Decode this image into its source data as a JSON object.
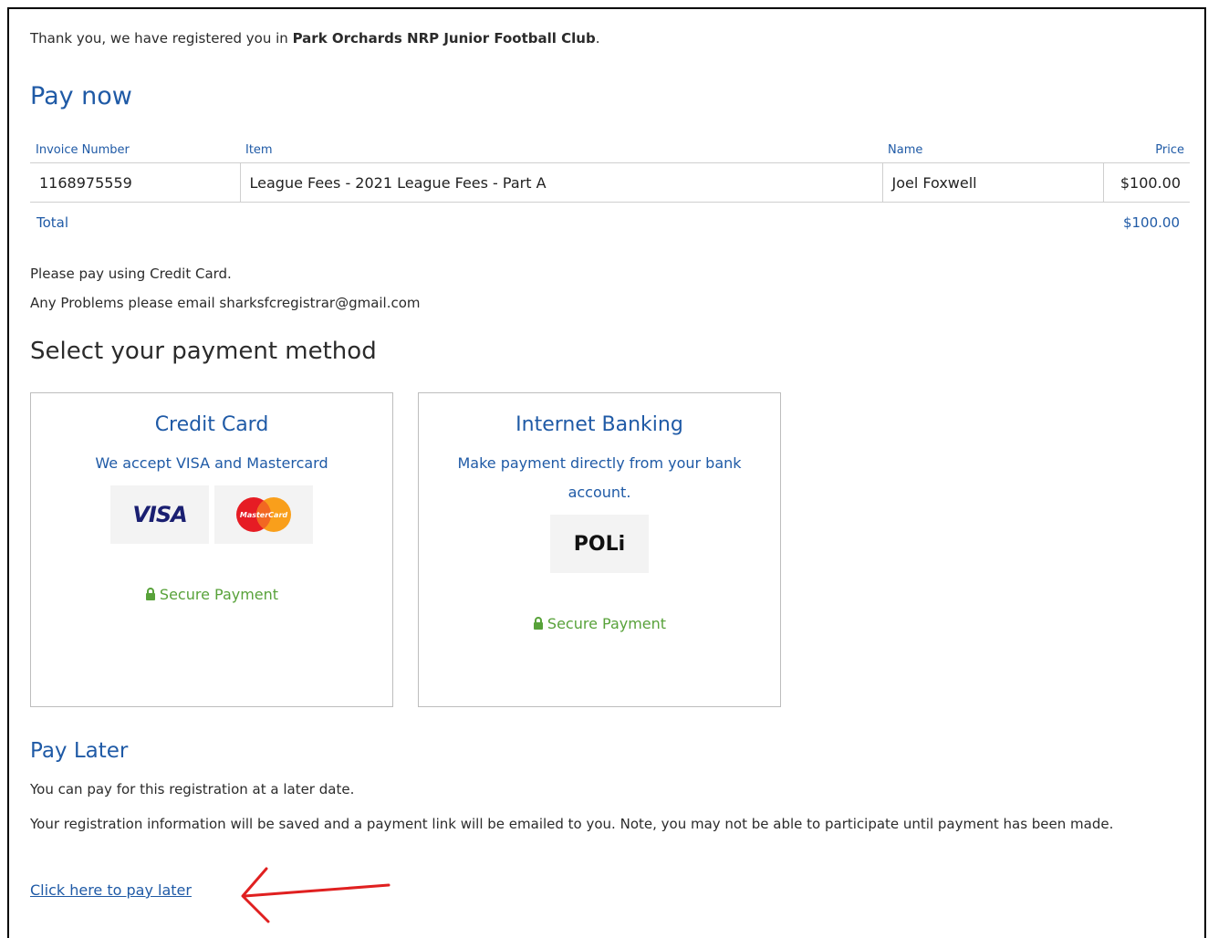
{
  "intro": {
    "prefix": "Thank you, we have registered you in ",
    "club_name": "Park Orchards NRP Junior Football Club",
    "suffix": "."
  },
  "pay_now": {
    "title": "Pay now",
    "columns": {
      "invoice_number": "Invoice Number",
      "item": "Item",
      "name": "Name",
      "price": "Price"
    },
    "rows": [
      {
        "invoice_number": "1168975559",
        "item": "League Fees - 2021 League Fees - Part A",
        "name": "Joel Foxwell",
        "price": "$100.00"
      }
    ],
    "total_label": "Total",
    "total_value": "$100.00"
  },
  "instructions": {
    "line1": "Please pay using Credit Card.",
    "line2": "Any Problems please email sharksfcregistrar@gmail.com"
  },
  "payment_methods": {
    "title": "Select your payment method",
    "credit_card": {
      "title": "Credit Card",
      "description": "We accept VISA and Mastercard",
      "visa_logo": "VISA",
      "mastercard_logo": "MasterCard",
      "secure": "Secure Payment"
    },
    "internet_banking": {
      "title": "Internet Banking",
      "description": "Make payment directly from your bank account.",
      "poli_logo": "POLi",
      "secure": "Secure Payment"
    }
  },
  "pay_later": {
    "title": "Pay Later",
    "text1": "You can pay for this registration at a later date.",
    "text2": "Your registration information will be saved and a payment link will be emailed to you. Note, you may not be able to participate until payment has been made.",
    "link": "Click here to pay later"
  },
  "colors": {
    "accent_blue": "#1f5aa6",
    "secure_green": "#58a23a",
    "annotation_red": "#e02020"
  }
}
